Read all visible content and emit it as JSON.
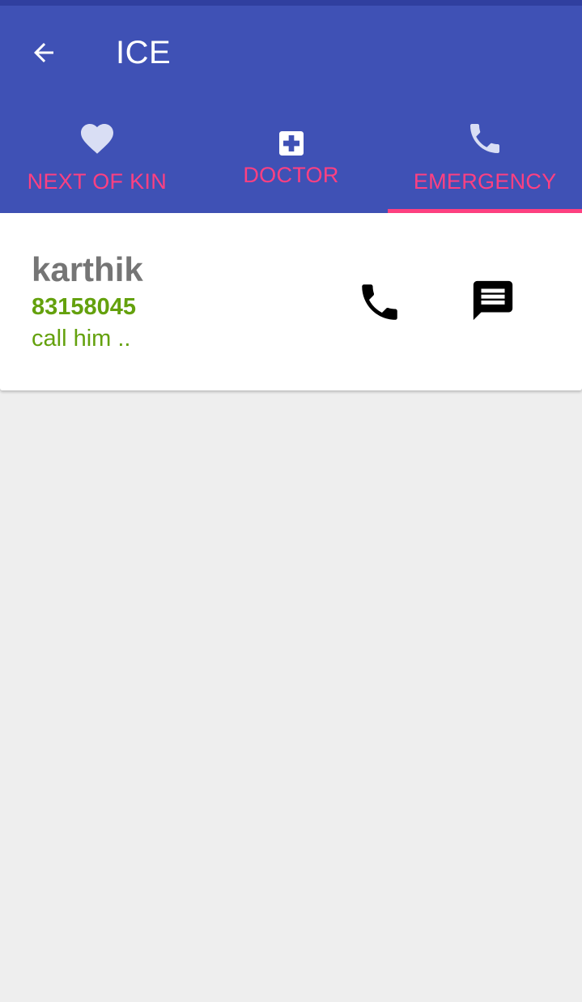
{
  "app": {
    "title": "ICE",
    "back_icon": "arrow-back-icon"
  },
  "tabs": [
    {
      "label": "NEXT OF KIN",
      "icon": "heart-icon",
      "selected": false
    },
    {
      "label": "DOCTOR",
      "icon": "medical-cross-icon",
      "selected": false
    },
    {
      "label": "EMERGENCY",
      "icon": "phone-icon",
      "selected": true
    }
  ],
  "contact": {
    "name": "karthik",
    "number": "83158045",
    "note": "call him ..",
    "call_icon": "phone-icon",
    "message_icon": "message-icon"
  },
  "colors": {
    "primary": "#3f51b5",
    "primary_dark": "#303f9f",
    "accent": "#ff4081",
    "tab_icon": "#d9def4",
    "contact_green": "#64a10d",
    "name_gray": "#757575",
    "background": "#eeeeee"
  }
}
